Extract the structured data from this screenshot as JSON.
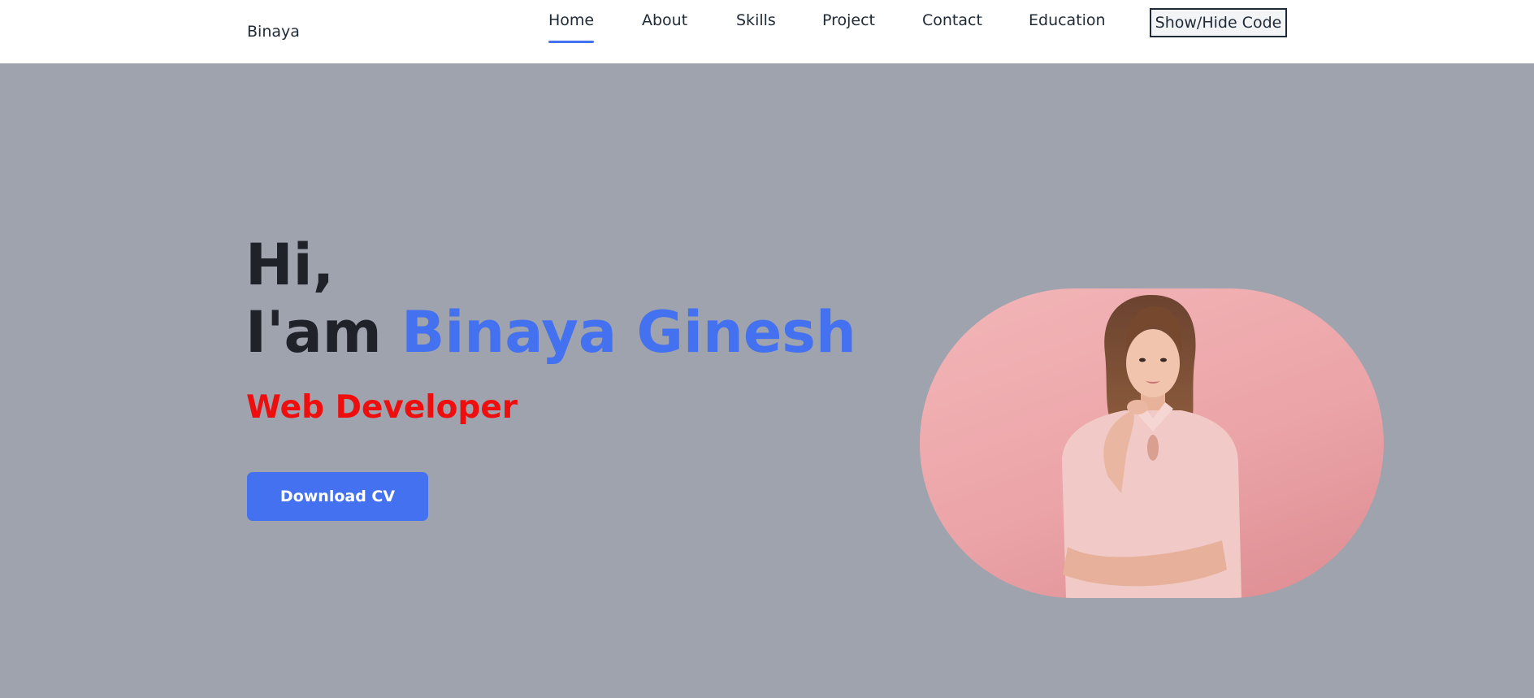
{
  "navbar": {
    "brand": "Binaya",
    "links": [
      {
        "label": "Home",
        "active": true
      },
      {
        "label": "About",
        "active": false
      },
      {
        "label": "Skills",
        "active": false
      },
      {
        "label": "Project",
        "active": false
      },
      {
        "label": "Contact",
        "active": false
      },
      {
        "label": "Education",
        "active": false
      }
    ],
    "toggle_label": "Show/Hide Code"
  },
  "hero": {
    "greeting": "Hi,",
    "intro": "I'am",
    "name": "Binaya Ginesh",
    "role": "Web Developer",
    "cta_label": "Download CV",
    "photo_icon": "portrait-photo"
  },
  "colors": {
    "accent": "#4471ef",
    "role": "#ee0e0e",
    "page_background": "#9ea3ae",
    "nav_background": "#ffffff",
    "text": "#1f2228"
  }
}
